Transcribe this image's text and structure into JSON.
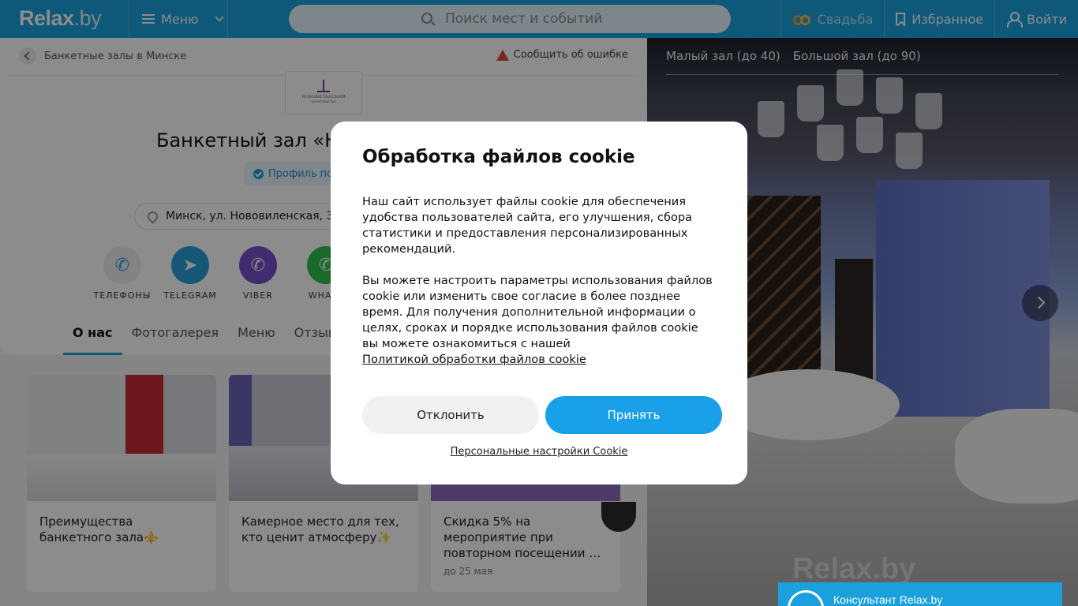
{
  "header": {
    "logo": "Relax",
    "logo_suffix": ".by",
    "menu_label": "Меню",
    "search_placeholder": "Поиск мест и событий",
    "wedding_label": "Свадьба",
    "favorites_label": "Избранное",
    "login_label": "Войти"
  },
  "breadcrumb": {
    "label": "Банкетные залы в Минске"
  },
  "report_error": "Сообщить об ошибке",
  "venue": {
    "logo_brand": "НОВОВИЛЕНСКИЙ",
    "logo_sub": "БАНКЕТНЫЙ ЗАЛ",
    "title": "Банкетный зал «Н",
    "verified_label": "Профиль по",
    "address": "Минск, ул. Нововиленская, 3"
  },
  "contacts": [
    {
      "label": "ТЕЛЕФОНЫ",
      "icon": "phone-icon"
    },
    {
      "label": "TELEGRAM",
      "icon": "telegram-icon"
    },
    {
      "label": "VIBER",
      "icon": "viber-icon"
    },
    {
      "label": "WHATS",
      "icon": "whatsapp-icon"
    }
  ],
  "tabs": [
    {
      "label": "О нас",
      "active": true
    },
    {
      "label": "Фотогалерея",
      "active": false
    },
    {
      "label": "Меню",
      "active": false
    },
    {
      "label": "Отзывы",
      "active": false
    }
  ],
  "promos": [
    {
      "title": "Преимущества банкетного зала⚜️",
      "date": ""
    },
    {
      "title": "Камерное место для тех, кто ценит атмосферу✨",
      "date": ""
    },
    {
      "title": "Скидка 5% на мероприятие при повторном посещении …",
      "date": "до 25 мая"
    }
  ],
  "gallery": {
    "halls": [
      "Малый зал (до 40)",
      "Большой зал (до 90)"
    ],
    "watermark": "Relax.by"
  },
  "chat": {
    "title": "Консультант Relax.by"
  },
  "cookie_modal": {
    "title": "Обработка файлов cookie",
    "paragraph1": "Наш сайт использует файлы cookie для обеспечения удобства пользователей сайта, его улучшения, сбора статистики и предоставления персонализированных рекомендаций.",
    "paragraph2": "Вы можете настроить параметры использования файлов cookie или изменить свое согласие в более позднее время. Для получения дополнительной информации о целях, сроках и порядке использования файлов cookie вы можете ознакомиться с нашей",
    "policy_link": "Политикой обработки файлов cookie",
    "decline_label": "Отклонить",
    "accept_label": "Принять",
    "settings_link": "Персональные настройки Cookie"
  },
  "colors": {
    "header_blue": "#1aa0dc",
    "accept_blue": "#1aa0e8",
    "warning_red": "#e04836"
  }
}
